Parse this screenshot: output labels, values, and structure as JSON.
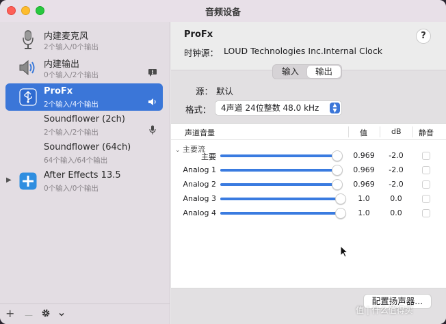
{
  "window": {
    "title": "音频设备"
  },
  "sidebar": {
    "devices": [
      {
        "name": "内建麦克风",
        "sub": "2个输入/0个输出",
        "icon": "microphone-icon"
      },
      {
        "name": "内建输出",
        "sub": "0个输入/2个输出",
        "icon": "speaker-icon",
        "trail": "alert-icon"
      },
      {
        "name": "ProFx",
        "sub": "2个输入/4个输出",
        "icon": "usb-icon",
        "trail": "volume-icon",
        "selected": true
      },
      {
        "name": "Soundflower (2ch)",
        "sub": "2个输入/2个输出",
        "trail": "mic-small-icon"
      },
      {
        "name": "Soundflower (64ch)",
        "sub": "64个输入/64个输出"
      },
      {
        "name": "After Effects 13.5",
        "sub": "0个输入/0个输出",
        "icon": "plus-icon"
      }
    ],
    "bottom": {
      "add": "+",
      "remove": "—"
    }
  },
  "detail": {
    "device_name": "ProFx",
    "clock_label": "时钟源：",
    "clock_value": "LOUD Technologies Inc.Internal Clock",
    "help": "?",
    "tabs": [
      {
        "label": "输入"
      },
      {
        "label": "输出"
      }
    ],
    "active_tab": "输出",
    "source_label": "源：",
    "source_value": "默认",
    "format_label": "格式：",
    "format_value": "4声道 24位整数 48.0 kHz",
    "table": {
      "headers": {
        "channel": "声道音量",
        "value": "值",
        "db": "dB",
        "mute": "静音"
      },
      "group": "主要流",
      "rows": [
        {
          "label": "主要",
          "value": "0.969",
          "db": "-2.0",
          "level": 0.969
        },
        {
          "label": "Analog 1",
          "value": "0.969",
          "db": "-2.0",
          "level": 0.969
        },
        {
          "label": "Analog 2",
          "value": "0.969",
          "db": "-2.0",
          "level": 0.969
        },
        {
          "label": "Analog 3",
          "value": "1.0",
          "db": "0.0",
          "level": 1.0
        },
        {
          "label": "Analog 4",
          "value": "1.0",
          "db": "0.0",
          "level": 1.0
        }
      ]
    },
    "speaker_button": "配置扬声器..."
  },
  "watermark": "值 | 什么值得买",
  "colors": {
    "accent": "#3b76d8",
    "slider": "#3a7be0"
  }
}
